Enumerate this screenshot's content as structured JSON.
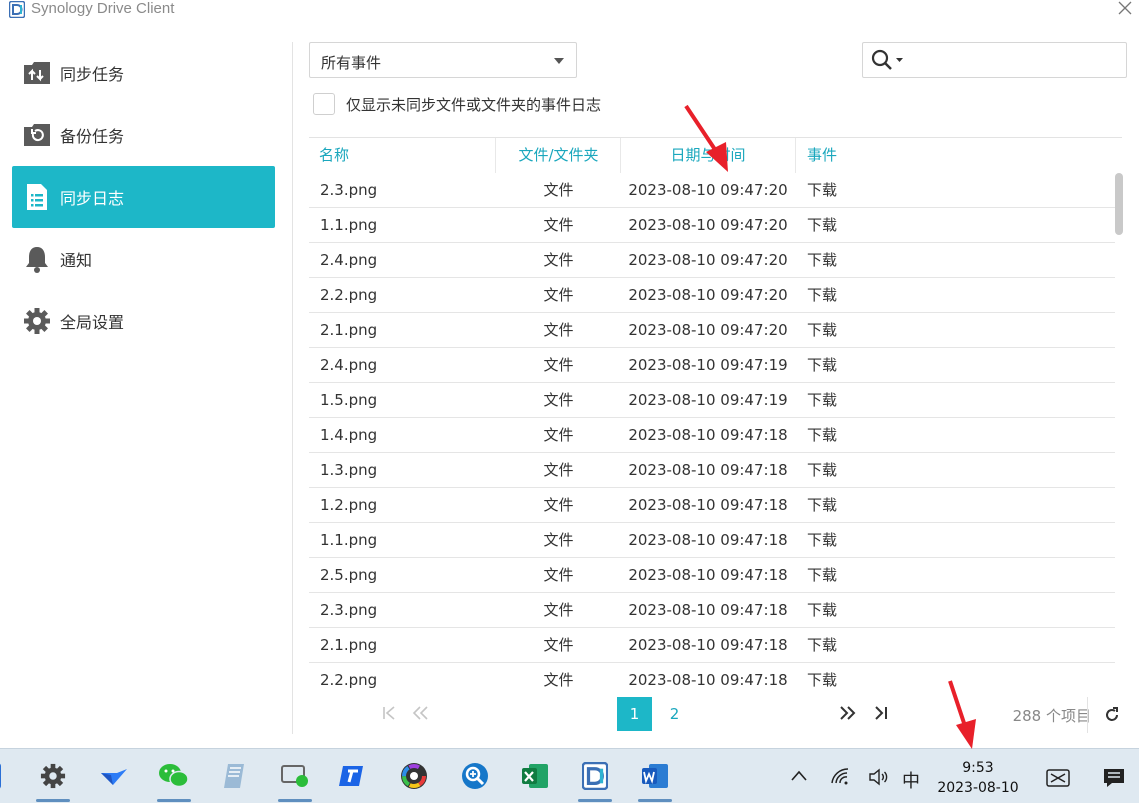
{
  "window": {
    "title": "Synology Drive Client"
  },
  "sidebar": {
    "items": [
      {
        "label": "同步任务",
        "icon": "sync-task-icon",
        "active": false
      },
      {
        "label": "备份任务",
        "icon": "backup-task-icon",
        "active": false
      },
      {
        "label": "同步日志",
        "icon": "sync-log-icon",
        "active": true
      },
      {
        "label": "通知",
        "icon": "bell-icon",
        "active": false
      },
      {
        "label": "全局设置",
        "icon": "gear-icon",
        "active": false
      }
    ]
  },
  "filter": {
    "event_select": "所有事件",
    "search_placeholder": "",
    "only_unsynced_label": "仅显示未同步文件或文件夹的事件日志",
    "only_unsynced_checked": false
  },
  "table": {
    "headers": {
      "name": "名称",
      "type": "文件/文件夹",
      "datetime": "日期与时间",
      "event": "事件"
    },
    "rows": [
      {
        "name": "2.3.png",
        "type": "文件",
        "datetime": "2023-08-10 09:47:20",
        "event": "下载"
      },
      {
        "name": "1.1.png",
        "type": "文件",
        "datetime": "2023-08-10 09:47:20",
        "event": "下载"
      },
      {
        "name": "2.4.png",
        "type": "文件",
        "datetime": "2023-08-10 09:47:20",
        "event": "下载"
      },
      {
        "name": "2.2.png",
        "type": "文件",
        "datetime": "2023-08-10 09:47:20",
        "event": "下载"
      },
      {
        "name": "2.1.png",
        "type": "文件",
        "datetime": "2023-08-10 09:47:20",
        "event": "下载"
      },
      {
        "name": "2.4.png",
        "type": "文件",
        "datetime": "2023-08-10 09:47:19",
        "event": "下载"
      },
      {
        "name": "1.5.png",
        "type": "文件",
        "datetime": "2023-08-10 09:47:19",
        "event": "下载"
      },
      {
        "name": "1.4.png",
        "type": "文件",
        "datetime": "2023-08-10 09:47:18",
        "event": "下载"
      },
      {
        "name": "1.3.png",
        "type": "文件",
        "datetime": "2023-08-10 09:47:18",
        "event": "下载"
      },
      {
        "name": "1.2.png",
        "type": "文件",
        "datetime": "2023-08-10 09:47:18",
        "event": "下载"
      },
      {
        "name": "1.1.png",
        "type": "文件",
        "datetime": "2023-08-10 09:47:18",
        "event": "下载"
      },
      {
        "name": "2.5.png",
        "type": "文件",
        "datetime": "2023-08-10 09:47:18",
        "event": "下载"
      },
      {
        "name": "2.3.png",
        "type": "文件",
        "datetime": "2023-08-10 09:47:18",
        "event": "下载"
      },
      {
        "name": "2.1.png",
        "type": "文件",
        "datetime": "2023-08-10 09:47:18",
        "event": "下载"
      },
      {
        "name": "2.2.png",
        "type": "文件",
        "datetime": "2023-08-10 09:47:18",
        "event": "下载"
      }
    ]
  },
  "pager": {
    "pages": [
      "1",
      "2"
    ],
    "current_page": "1",
    "total_label": "288 个项目"
  },
  "taskbar": {
    "apps": [
      "settings-icon",
      "feishu-icon",
      "wechat-icon",
      "notepad-icon",
      "remote-desktop-icon",
      "tencent-app-icon",
      "color-wheel-icon",
      "zoom-search-icon",
      "excel-icon",
      "synology-drive-icon",
      "word-icon"
    ],
    "ime": "中",
    "time": "9:53",
    "date": "2023-08-10"
  },
  "colors": {
    "accent": "#1db7c8",
    "header_text": "#1aa7bd",
    "annotation_arrow": "#e8202a"
  }
}
